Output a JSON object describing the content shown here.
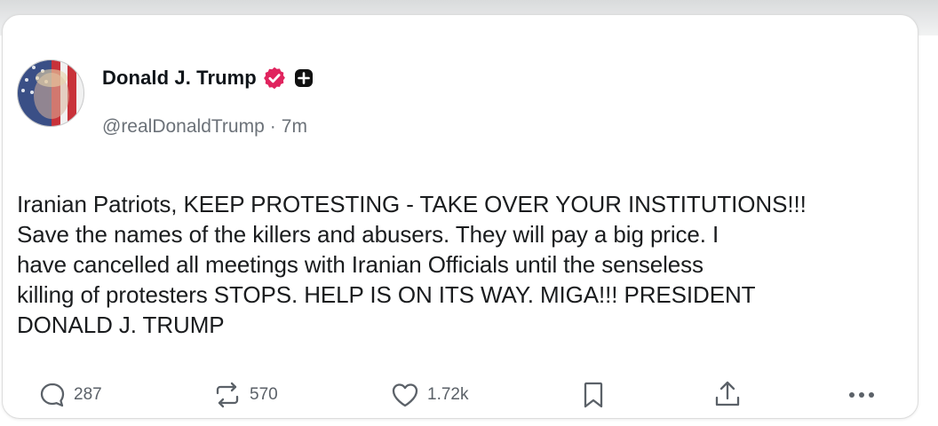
{
  "post": {
    "author": {
      "name": "Donald J. Trump",
      "handle": "@realDonaldTrump",
      "separator": "·",
      "time": "7m"
    },
    "text": "Iranian Patriots, KEEP PROTESTING - TAKE OVER YOUR INSTITUTIONS!!!\nSave the names of the killers and abusers. They will pay a big price. I\nhave cancelled all meetings with Iranian Officials until the senseless\nkilling of protesters STOPS. HELP IS ON ITS WAY. MIGA!!! PRESIDENT\nDONALD J. TRUMP",
    "stats": {
      "replies": "287",
      "reposts": "570",
      "likes": "1.72k"
    }
  },
  "icons": {
    "verified_badge": "verified-badge-icon",
    "plus_badge": "plus-badge-icon",
    "reply": "reply-icon",
    "repost": "repost-icon",
    "like": "heart-icon",
    "bookmark": "bookmark-icon",
    "share": "share-icon",
    "more": "more-icon"
  },
  "colors": {
    "verified_badge": "#e0245e",
    "text": "#1a1c1e",
    "muted": "#6b7178"
  }
}
